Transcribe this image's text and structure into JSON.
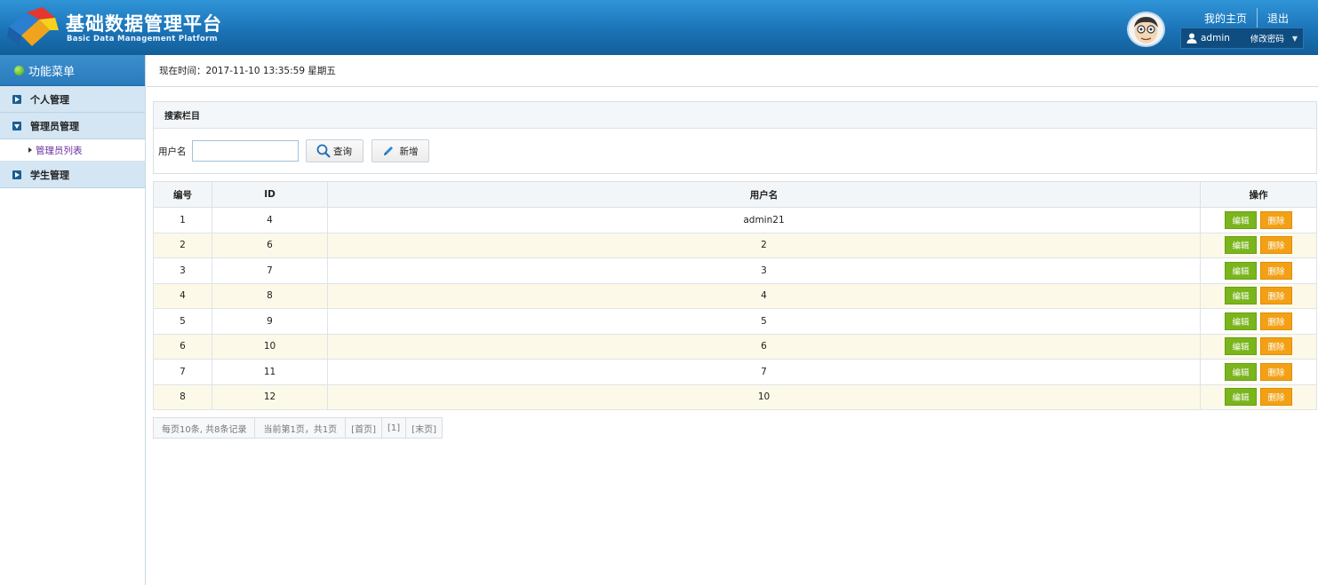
{
  "header": {
    "title": "基础数据管理平台",
    "subtitle": "Basic Data Management Platform",
    "home_link": "我的主页",
    "logout_link": "退出",
    "username": "admin",
    "change_password": "修改密码"
  },
  "sidebar": {
    "title": "功能菜单",
    "groups": [
      {
        "label": "个人管理",
        "expanded": false
      },
      {
        "label": "管理员管理",
        "expanded": true,
        "items": [
          {
            "label": "管理员列表"
          }
        ]
      },
      {
        "label": "学生管理",
        "expanded": false
      }
    ]
  },
  "timebar": {
    "text": "现在时间：2017-11-10 13:35:59 星期五"
  },
  "search": {
    "title": "搜索栏目",
    "username_label": "用户名",
    "username_value": "",
    "query_label": "查询",
    "add_label": "新增"
  },
  "table": {
    "headers": [
      "编号",
      "ID",
      "用户名",
      "操作"
    ],
    "edit_label": "编辑",
    "delete_label": "删除",
    "rows": [
      {
        "no": "1",
        "id": "4",
        "username": "admin21"
      },
      {
        "no": "2",
        "id": "6",
        "username": "2"
      },
      {
        "no": "3",
        "id": "7",
        "username": "3"
      },
      {
        "no": "4",
        "id": "8",
        "username": "4"
      },
      {
        "no": "5",
        "id": "9",
        "username": "5"
      },
      {
        "no": "6",
        "id": "10",
        "username": "6"
      },
      {
        "no": "7",
        "id": "11",
        "username": "7"
      },
      {
        "no": "8",
        "id": "12",
        "username": "10"
      }
    ]
  },
  "pager": {
    "summary": "每页10条, 共8条记录",
    "current": "当前第1页，共1页",
    "first": "[首页]",
    "page1": "[1]",
    "last": "[末页]"
  },
  "colors": {
    "header_blue": "#1b73b7",
    "edit_green": "#7ab51d",
    "delete_orange": "#f2a116",
    "even_row": "#fdf9e8"
  }
}
